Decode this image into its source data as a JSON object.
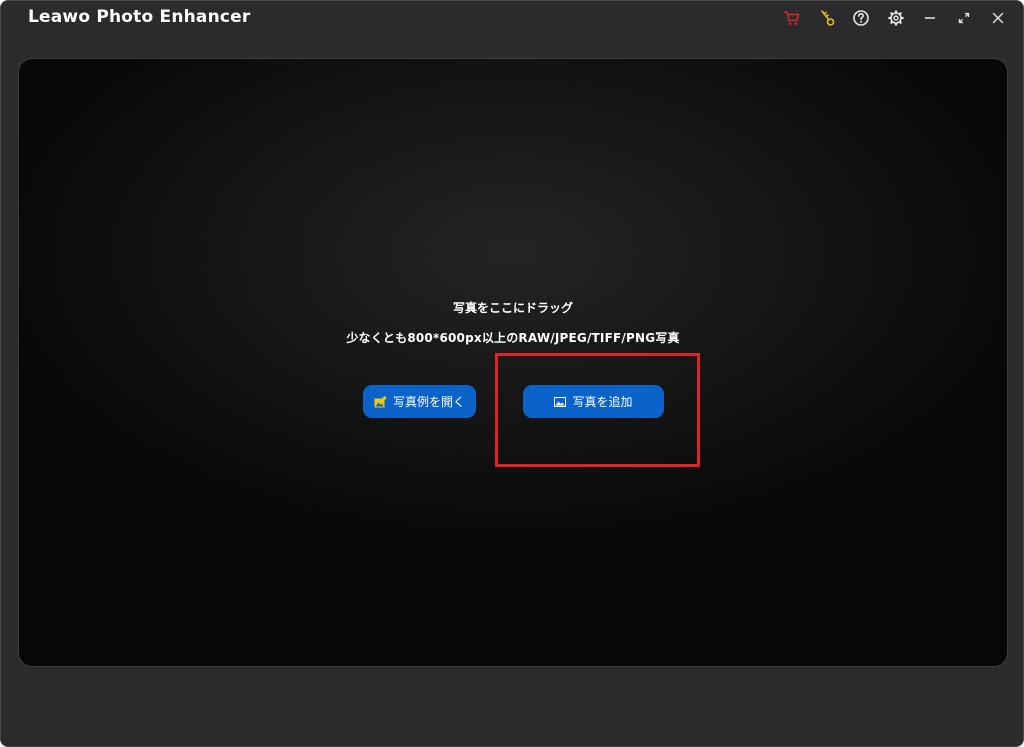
{
  "window": {
    "title": "Leawo Photo Enhancer"
  },
  "titlebar": {
    "icons": {
      "cart": "cart-icon",
      "key": "key-icon",
      "help": "help-icon",
      "settings": "gear-icon",
      "minimize": "minimize-icon",
      "maximize": "maximize-icon",
      "close": "close-icon"
    },
    "colors": {
      "cart": "#e0222b",
      "key": "#e8b923",
      "default": "#e6e6e6"
    }
  },
  "dropzone": {
    "drag_text": "写真をここにドラッグ",
    "requirement_text": "少なくとも800*600px以上のRAW/JPEG/TIFF/PNG写真"
  },
  "buttons": {
    "open_sample": {
      "label": "写真例を開く",
      "icon": "sample-photo-icon"
    },
    "add_photo": {
      "label": "写真を追加",
      "icon": "image-icon"
    }
  },
  "colors": {
    "window_bg": "#2b2b2d",
    "button_blue": "#0b63c9",
    "highlight_red": "#e0222b"
  }
}
